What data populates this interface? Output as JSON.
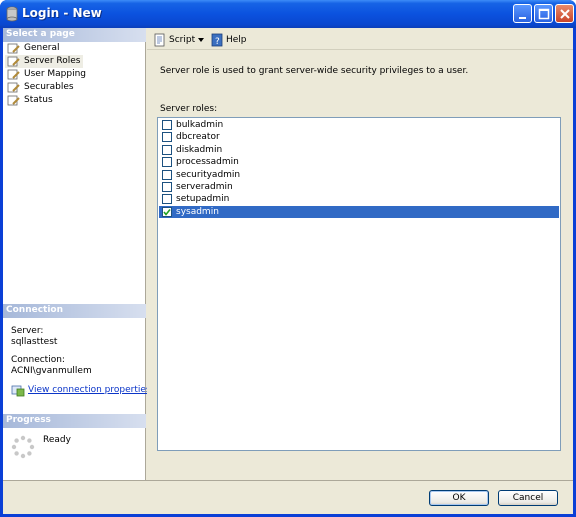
{
  "window": {
    "title": "Login - New"
  },
  "left": {
    "select_page_header": "Select a page",
    "pages": [
      {
        "label": "General",
        "icon": "page-wrench-icon",
        "selected": false
      },
      {
        "label": "Server Roles",
        "icon": "page-wrench-icon",
        "selected": true
      },
      {
        "label": "User Mapping",
        "icon": "page-wrench-icon",
        "selected": false
      },
      {
        "label": "Securables",
        "icon": "page-wrench-icon",
        "selected": false
      },
      {
        "label": "Status",
        "icon": "page-wrench-icon",
        "selected": false
      }
    ],
    "connection_header": "Connection",
    "server_label": "Server:",
    "server_value": "sqllasttest",
    "connection_label": "Connection:",
    "connection_value": "ACNI\\gvanmullem",
    "view_connection_link": "View connection properties",
    "progress_header": "Progress",
    "progress_status": "Ready"
  },
  "toolbar": {
    "script_label": "Script",
    "help_label": "Help"
  },
  "main": {
    "description": "Server role is used to grant server-wide security privileges to a user.",
    "roles_label": "Server roles:",
    "roles": [
      {
        "name": "bulkadmin",
        "checked": false,
        "selected": false
      },
      {
        "name": "dbcreator",
        "checked": false,
        "selected": false
      },
      {
        "name": "diskadmin",
        "checked": false,
        "selected": false
      },
      {
        "name": "processadmin",
        "checked": false,
        "selected": false
      },
      {
        "name": "securityadmin",
        "checked": false,
        "selected": false
      },
      {
        "name": "serveradmin",
        "checked": false,
        "selected": false
      },
      {
        "name": "setupadmin",
        "checked": false,
        "selected": false
      },
      {
        "name": "sysadmin",
        "checked": true,
        "selected": true
      }
    ]
  },
  "footer": {
    "ok_label": "OK",
    "cancel_label": "Cancel"
  },
  "colors": {
    "selection": "#316ac5",
    "titlebar": "#0a52df",
    "link": "#0b35c8"
  }
}
